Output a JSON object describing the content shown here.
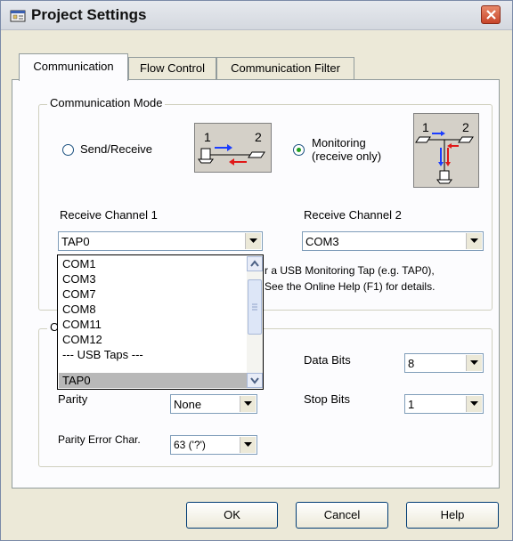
{
  "window": {
    "title": "Project Settings"
  },
  "tabs": [
    {
      "label": "Communication",
      "active": true
    },
    {
      "label": "Flow Control",
      "active": false
    },
    {
      "label": "Communication Filter",
      "active": false
    }
  ],
  "communication_mode": {
    "legend": "Communication Mode",
    "send_receive_label": "Send/Receive",
    "monitoring_label_line1": "Monitoring",
    "monitoring_label_line2": "(receive only)",
    "selected": "monitoring"
  },
  "receive_channel_1": {
    "label": "Receive Channel 1",
    "value": "TAP0",
    "options": [
      "COM1",
      "COM3",
      "COM7",
      "COM8",
      "COM11",
      "COM12",
      "--- USB Taps ---",
      "TAP0"
    ]
  },
  "receive_channel_2": {
    "label": "Receive Channel 2",
    "value": "COM3"
  },
  "hint": {
    "line1": "r a USB Monitoring Tap (e.g. TAP0),",
    "line2": "See the Online Help (F1) for details."
  },
  "port_settings": {
    "legend_char": "C",
    "data_bits_label": "Data Bits",
    "data_bits_value": "8",
    "stop_bits_label": "Stop Bits",
    "stop_bits_value": "1",
    "parity_label": "Parity",
    "parity_value": "None",
    "parity_error_label": "Parity Error Char.",
    "parity_error_value": "63 ('?')"
  },
  "buttons": {
    "ok": "OK",
    "cancel": "Cancel",
    "help": "Help"
  },
  "colors": {
    "arrow_blue": "#1a3cff",
    "arrow_red": "#e01818",
    "selected_item": "#b8b8b8"
  }
}
